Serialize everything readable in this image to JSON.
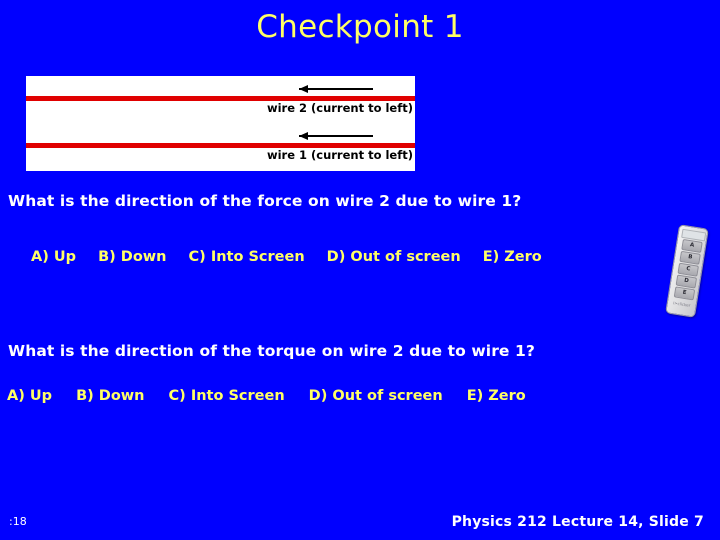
{
  "slide": {
    "title": "Checkpoint 1",
    "background_color": "#0000ff",
    "title_color": "#ffff66",
    "question_color": "#ffffff",
    "answer_color": "#ffff66",
    "wire_color": "#e00000"
  },
  "figure": {
    "wire2": {
      "label": "wire 2 (current to left)",
      "arrow_direction": "left"
    },
    "wire1": {
      "label": "wire 1 (current to left)",
      "arrow_direction": "left"
    }
  },
  "questions": [
    {
      "text": "What is the direction of the force on wire 2 due to wire 1?",
      "options": [
        "A) Up",
        "B) Down",
        "C) Into Screen",
        "D) Out of screen",
        "E) Zero"
      ]
    },
    {
      "text": "What is the direction of the torque on wire 2 due to wire 1?",
      "options": [
        "A) Up",
        "B) Down",
        "C) Into Screen",
        "D) Out of screen",
        "E) Zero"
      ]
    }
  ],
  "clicker": {
    "buttons": [
      "A",
      "B",
      "C",
      "D",
      "E"
    ],
    "brand": "i>clicker"
  },
  "footer": {
    "timer": ":18",
    "credit": "Physics 212  Lecture 14, Slide  7"
  }
}
